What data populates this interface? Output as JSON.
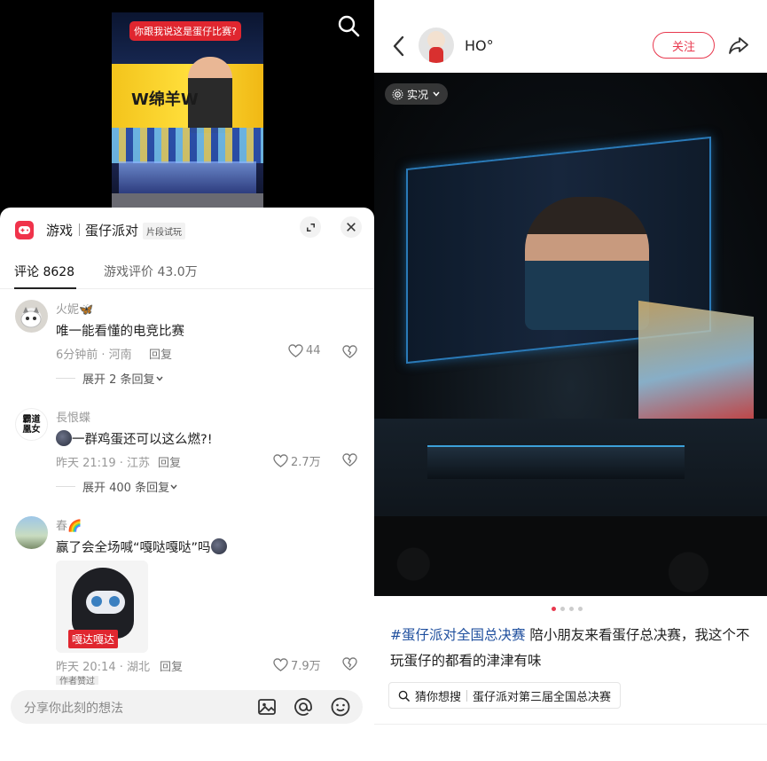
{
  "left": {
    "video": {
      "banner": "你跟我说这是蛋仔比赛?",
      "screen_text": "W绵羊W"
    },
    "sheet": {
      "category": "游戏",
      "game_name": "蛋仔派对",
      "tag": "片段试玩",
      "tabs": [
        {
          "label": "评论 8628"
        },
        {
          "label": "游戏评价 43.0万"
        }
      ],
      "comments": [
        {
          "user": "火妮🦋",
          "text": "唯一能看懂的电竞比赛",
          "time_loc": "6分钟前 · 河南",
          "reply": "回复",
          "likes": "44",
          "expand": "展开 2 条回复"
        },
        {
          "user": "長恨蝶",
          "avatar_text": "霸道凰女",
          "text": "一群鸡蛋还可以这么燃?!",
          "time_loc": "昨天 21:19 · 江苏",
          "reply": "回复",
          "likes": "2.7万",
          "expand": "展开 400 条回复"
        },
        {
          "user": "春🌈",
          "text_before": "赢了会全场喊“嘎哒嘎哒”吗",
          "sticker_label": "嘎达嘎达",
          "time_loc": "昨天 20:14 · 湖北",
          "reply": "回复",
          "likes": "7.9万",
          "author_liked": "作者赞过"
        }
      ],
      "input_placeholder": "分享你此刻的想法"
    }
  },
  "right": {
    "username": "HO°",
    "follow_label": "关注",
    "live_label": "实况",
    "caption_hashtag": "#蛋仔派对全国总决赛",
    "caption_text": " 陪小朋友来看蛋仔总决赛，我这个不玩蛋仔的都看的津津有味",
    "guess_label": "猜你想搜",
    "guess_query": "蛋仔派对第三届全国总决赛",
    "carousel": {
      "count": 4,
      "active_index": 1
    }
  },
  "colors": {
    "accent_red": "#e8384e",
    "hashtag_blue": "#1f4f9e",
    "game_icon": "#f0334b"
  },
  "icons": [
    "search-icon",
    "game-controller-icon",
    "expand-icon",
    "close-icon",
    "heart-icon",
    "broken-heart-icon",
    "chevron-down-icon",
    "image-icon",
    "at-icon",
    "emoji-icon",
    "back-icon",
    "share-icon",
    "live-photo-icon"
  ]
}
